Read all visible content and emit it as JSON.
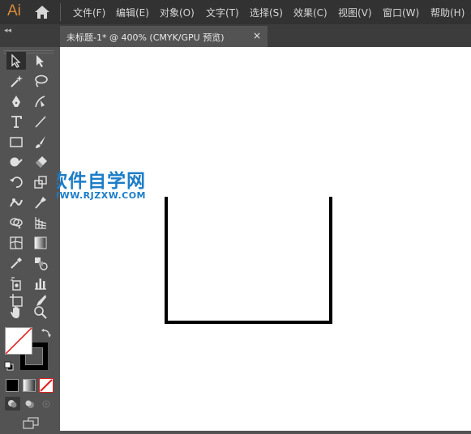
{
  "app": {
    "logo": "Ai"
  },
  "menu": {
    "items": [
      "文件(F)",
      "编辑(E)",
      "对象(O)",
      "文字(T)",
      "选择(S)",
      "效果(C)",
      "视图(V)",
      "窗口(W)",
      "帮助(H)"
    ]
  },
  "document": {
    "tab_label": "未标题-1* @ 400% (CMYK/GPU 预览)",
    "close_glyph": "×"
  },
  "toolbar": {
    "collapse_glyph": "◂◂"
  },
  "watermark": {
    "title": "软件自学网",
    "url": "WWW.RJZXW.COM"
  },
  "colors": {
    "menubar": "#323232",
    "panel": "#535353",
    "canvas": "#ffffff",
    "accent_logo": "#d98b3a",
    "watermark": "#1c7dc7",
    "stroke": "#000000",
    "none_swatch_slash": "#e02020"
  },
  "icons": [
    "home-icon",
    "selection-tool-icon",
    "direct-selection-tool-icon",
    "magic-wand-icon",
    "lasso-icon",
    "pen-tool-icon",
    "curvature-tool-icon",
    "type-tool-icon",
    "line-segment-icon",
    "rectangle-tool-icon",
    "paintbrush-icon",
    "shaper-tool-icon",
    "eraser-icon",
    "rotate-tool-icon",
    "scale-tool-icon",
    "width-tool-icon",
    "puppet-warp-icon",
    "shape-builder-icon",
    "perspective-grid-icon",
    "mesh-tool-icon",
    "gradient-tool-icon",
    "eyedropper-icon",
    "blend-tool-icon",
    "symbol-sprayer-icon",
    "column-graph-icon",
    "artboard-tool-icon",
    "slice-tool-icon",
    "hand-tool-icon",
    "zoom-tool-icon",
    "swap-colors-icon",
    "default-colors-icon",
    "color-mode-icon",
    "gradient-mode-icon",
    "none-mode-icon",
    "draw-normal-icon",
    "draw-behind-icon",
    "draw-inside-icon",
    "screen-mode-icon"
  ]
}
